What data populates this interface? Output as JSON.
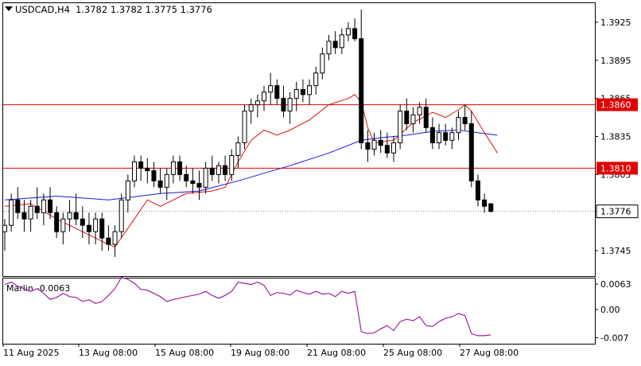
{
  "header": {
    "symbol_timeframe": "USDCAD,H4",
    "ohlc": "1.3782 1.3782 1.3775 1.3776"
  },
  "indicator": {
    "name": "Marlin",
    "value": "-0.0063"
  },
  "colors": {
    "bull_candle": "#ffffff",
    "bear_candle": "#000000",
    "candle_outline": "#000000",
    "ma_slow": "#1a1adc",
    "envelope": "#dc1414",
    "level_line": "#e00000",
    "oscillator": "#a020a0",
    "price_badge_current": "#ffffff",
    "price_badge_level": "#e00000"
  },
  "chart_data": [
    {
      "type": "candlestick",
      "ylim": [
        1.3725,
        1.394
      ],
      "y_ticks": [
        "1.3925",
        "1.3895",
        "1.3865",
        "1.3835",
        "1.3805",
        "1.3776",
        "1.3745"
      ],
      "x_tick_labels": [
        "11 Aug 2025",
        "13 Aug 08:00",
        "15 Aug 08:00",
        "19 Aug 08:00",
        "21 Aug 08:00",
        "25 Aug 08:00",
        "27 Aug 08:00"
      ],
      "current_price": "1.3776",
      "levels": [
        {
          "label": "1.3860",
          "value": 1.386
        },
        {
          "label": "1.3810",
          "value": 1.381
        }
      ],
      "candles": [
        [
          1.376,
          1.377,
          1.3745,
          1.3765
        ],
        [
          1.3765,
          1.379,
          1.376,
          1.3785
        ],
        [
          1.3785,
          1.3795,
          1.377,
          1.3775
        ],
        [
          1.3775,
          1.3785,
          1.376,
          1.377
        ],
        [
          1.377,
          1.3785,
          1.376,
          1.378
        ],
        [
          1.378,
          1.3795,
          1.377,
          1.3775
        ],
        [
          1.3775,
          1.379,
          1.3765,
          1.3785
        ],
        [
          1.3785,
          1.3795,
          1.377,
          1.3775
        ],
        [
          1.3775,
          1.378,
          1.3755,
          1.376
        ],
        [
          1.376,
          1.3775,
          1.375,
          1.377
        ],
        [
          1.377,
          1.3785,
          1.376,
          1.3775
        ],
        [
          1.3775,
          1.379,
          1.3765,
          1.377
        ],
        [
          1.377,
          1.378,
          1.3755,
          1.3765
        ],
        [
          1.3765,
          1.3775,
          1.375,
          1.376
        ],
        [
          1.376,
          1.3775,
          1.375,
          1.377
        ],
        [
          1.377,
          1.3775,
          1.3745,
          1.3755
        ],
        [
          1.3755,
          1.3765,
          1.3745,
          1.375
        ],
        [
          1.375,
          1.3765,
          1.374,
          1.376
        ],
        [
          1.376,
          1.379,
          1.3755,
          1.3785
        ],
        [
          1.3785,
          1.3805,
          1.3775,
          1.38
        ],
        [
          1.38,
          1.382,
          1.3795,
          1.3815
        ],
        [
          1.3815,
          1.382,
          1.38,
          1.381
        ],
        [
          1.381,
          1.3818,
          1.3798,
          1.3808
        ],
        [
          1.3808,
          1.3815,
          1.3795,
          1.38
        ],
        [
          1.38,
          1.381,
          1.379,
          1.3795
        ],
        [
          1.3795,
          1.381,
          1.3785,
          1.3805
        ],
        [
          1.3805,
          1.382,
          1.3798,
          1.3815
        ],
        [
          1.3815,
          1.382,
          1.38,
          1.3805
        ],
        [
          1.3805,
          1.3812,
          1.3795,
          1.38
        ],
        [
          1.38,
          1.381,
          1.379,
          1.3798
        ],
        [
          1.3798,
          1.3808,
          1.3785,
          1.3795
        ],
        [
          1.3795,
          1.3815,
          1.379,
          1.381
        ],
        [
          1.381,
          1.382,
          1.38,
          1.3805
        ],
        [
          1.3805,
          1.3815,
          1.3798,
          1.3812
        ],
        [
          1.3812,
          1.382,
          1.38,
          1.3805
        ],
        [
          1.3805,
          1.3825,
          1.38,
          1.382
        ],
        [
          1.382,
          1.3835,
          1.381,
          1.383
        ],
        [
          1.383,
          1.386,
          1.3825,
          1.3855
        ],
        [
          1.3855,
          1.3865,
          1.3845,
          1.386
        ],
        [
          1.386,
          1.3868,
          1.385,
          1.3863
        ],
        [
          1.3863,
          1.3875,
          1.3855,
          1.387
        ],
        [
          1.387,
          1.3885,
          1.386,
          1.3875
        ],
        [
          1.3875,
          1.388,
          1.386,
          1.3865
        ],
        [
          1.3865,
          1.3875,
          1.385,
          1.3855
        ],
        [
          1.3855,
          1.387,
          1.3845,
          1.3865
        ],
        [
          1.3865,
          1.3878,
          1.3855,
          1.3872
        ],
        [
          1.3872,
          1.388,
          1.3862,
          1.3868
        ],
        [
          1.3868,
          1.388,
          1.386,
          1.3875
        ],
        [
          1.3875,
          1.389,
          1.3868,
          1.3885
        ],
        [
          1.3885,
          1.3905,
          1.388,
          1.39
        ],
        [
          1.39,
          1.3915,
          1.3895,
          1.391
        ],
        [
          1.391,
          1.3918,
          1.39,
          1.3905
        ],
        [
          1.3905,
          1.392,
          1.39,
          1.3915
        ],
        [
          1.3915,
          1.3925,
          1.391,
          1.392
        ],
        [
          1.392,
          1.3928,
          1.391,
          1.3912
        ],
        [
          1.3912,
          1.3935,
          1.3825,
          1.383
        ],
        [
          1.383,
          1.384,
          1.3815,
          1.3825
        ],
        [
          1.3825,
          1.3838,
          1.382,
          1.3832
        ],
        [
          1.3832,
          1.384,
          1.3822,
          1.3828
        ],
        [
          1.3828,
          1.3838,
          1.3818,
          1.3822
        ],
        [
          1.3822,
          1.3835,
          1.3815,
          1.383
        ],
        [
          1.383,
          1.386,
          1.3825,
          1.3855
        ],
        [
          1.3855,
          1.3865,
          1.384,
          1.3845
        ],
        [
          1.3845,
          1.3858,
          1.3838,
          1.3852
        ],
        [
          1.3852,
          1.3862,
          1.3845,
          1.3858
        ],
        [
          1.3858,
          1.3865,
          1.3838,
          1.3842
        ],
        [
          1.3842,
          1.385,
          1.3825,
          1.383
        ],
        [
          1.383,
          1.3845,
          1.3825,
          1.3838
        ],
        [
          1.3838,
          1.3845,
          1.3828,
          1.3832
        ],
        [
          1.3832,
          1.3842,
          1.3825,
          1.3838
        ],
        [
          1.3838,
          1.3855,
          1.3832,
          1.385
        ],
        [
          1.385,
          1.386,
          1.384,
          1.3845
        ],
        [
          1.3845,
          1.3855,
          1.3795,
          1.38
        ],
        [
          1.38,
          1.3805,
          1.378,
          1.3785
        ],
        [
          1.3785,
          1.379,
          1.3775,
          1.378
        ],
        [
          1.3782,
          1.3782,
          1.3775,
          1.3776
        ]
      ],
      "ma_slow": [
        [
          0,
          1.3785
        ],
        [
          8,
          1.3788
        ],
        [
          16,
          1.3785
        ],
        [
          24,
          1.379
        ],
        [
          30,
          1.3792
        ],
        [
          36,
          1.38
        ],
        [
          44,
          1.3812
        ],
        [
          50,
          1.3822
        ],
        [
          55,
          1.3832
        ],
        [
          58,
          1.3834
        ],
        [
          62,
          1.3836
        ],
        [
          66,
          1.3839
        ],
        [
          70,
          1.384
        ],
        [
          73,
          1.3838
        ],
        [
          76,
          1.3836
        ]
      ],
      "envelope": [
        [
          0,
          1.378
        ],
        [
          4,
          1.3782
        ],
        [
          8,
          1.377
        ],
        [
          12,
          1.376
        ],
        [
          16,
          1.375
        ],
        [
          17,
          1.3748
        ],
        [
          20,
          1.377
        ],
        [
          22,
          1.3785
        ],
        [
          24,
          1.378
        ],
        [
          28,
          1.379
        ],
        [
          32,
          1.3792
        ],
        [
          34,
          1.3795
        ],
        [
          36,
          1.3815
        ],
        [
          38,
          1.3832
        ],
        [
          40,
          1.384
        ],
        [
          42,
          1.3836
        ],
        [
          44,
          1.384
        ],
        [
          47,
          1.3848
        ],
        [
          50,
          1.386
        ],
        [
          53,
          1.3865
        ],
        [
          54,
          1.3868
        ],
        [
          55,
          1.3862
        ],
        [
          56,
          1.3842
        ],
        [
          57,
          1.383
        ],
        [
          60,
          1.3832
        ],
        [
          63,
          1.3846
        ],
        [
          66,
          1.3854
        ],
        [
          68,
          1.385
        ],
        [
          70,
          1.3856
        ],
        [
          71,
          1.386
        ],
        [
          72,
          1.3855
        ],
        [
          74,
          1.3838
        ],
        [
          76,
          1.3822
        ]
      ]
    },
    {
      "type": "line",
      "series": [
        {
          "name": "Marlin",
          "values": [
            0.0062,
            0.0068,
            0.0058,
            0.0051,
            0.0045,
            0.0052,
            0.004,
            0.0025,
            0.003,
            0.004,
            0.0032,
            0.003,
            0.002,
            0.0024,
            0.0015,
            0.002,
            0.0035,
            0.0052,
            0.008,
            0.0075,
            0.0065,
            0.005,
            0.0048,
            0.004,
            0.0032,
            0.002,
            0.0025,
            0.0028,
            0.0032,
            0.0035,
            0.0038,
            0.0045,
            0.0035,
            0.0028,
            0.0035,
            0.0045,
            0.0068,
            0.0065,
            0.0062,
            0.0068,
            0.006,
            0.0035,
            0.0042,
            0.004,
            0.0036,
            0.0048,
            0.0042,
            0.0038,
            0.0045,
            0.0038,
            0.004,
            0.0032,
            0.0045,
            0.004,
            0.0045,
            -0.0055,
            -0.006,
            -0.0058,
            -0.0048,
            -0.004,
            -0.0052,
            -0.003,
            -0.0024,
            -0.0028,
            -0.0018,
            -0.004,
            -0.0042,
            -0.003,
            -0.0022,
            -0.0018,
            -0.001,
            -0.0015,
            -0.006,
            -0.0065,
            -0.0065,
            -0.0063
          ]
        }
      ],
      "ylim": [
        -0.0085,
        0.0077
      ],
      "y_ticks": [
        "0.0063",
        "0.00",
        "-0.007"
      ]
    }
  ]
}
